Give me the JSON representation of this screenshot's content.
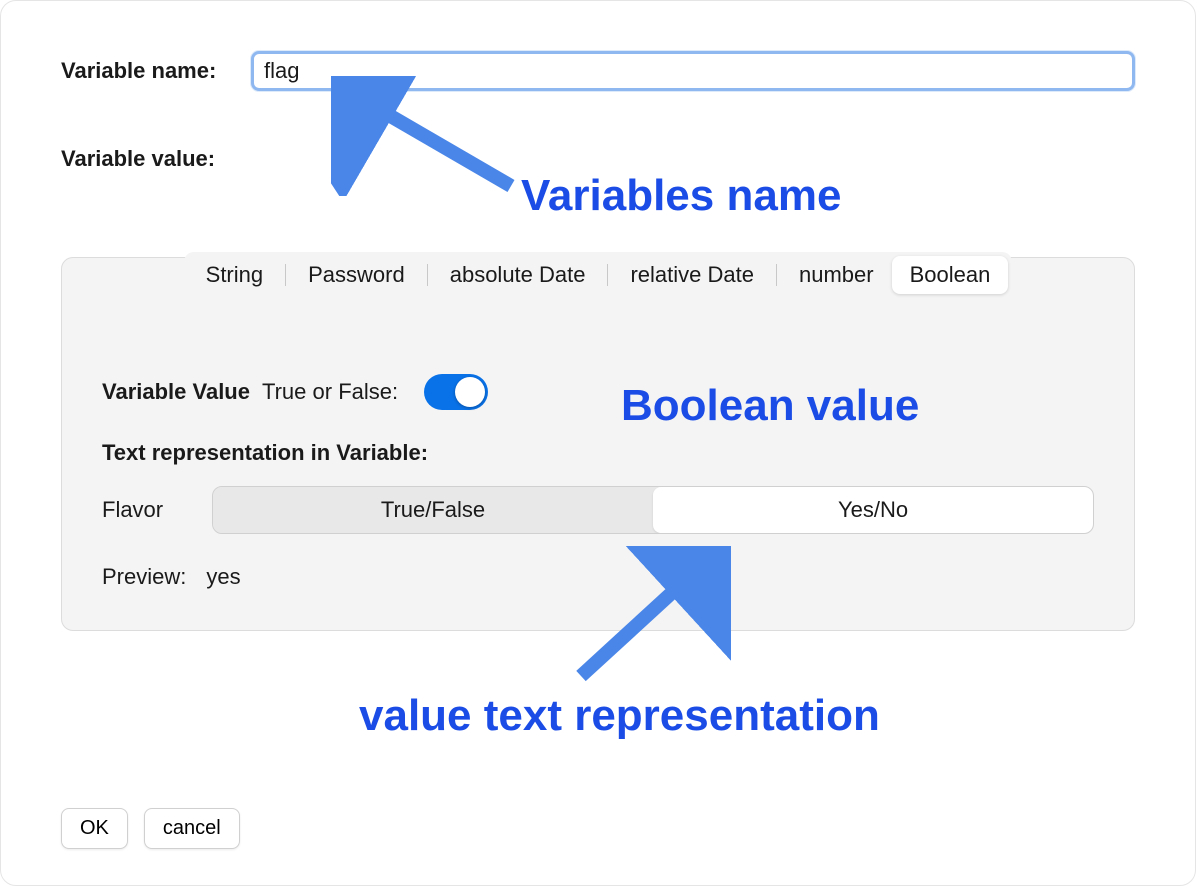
{
  "labels": {
    "variable_name": "Variable name:",
    "variable_value_section": "Variable value:",
    "variable_value_inline": "Variable Value",
    "true_or_false": "True or False:",
    "text_representation": "Text representation in Variable:",
    "flavor": "Flavor",
    "preview": "Preview:"
  },
  "inputs": {
    "variable_name_value": "flag"
  },
  "tabs": {
    "items": [
      "String",
      "Password",
      "absolute Date",
      "relative Date",
      "number",
      "Boolean"
    ],
    "active_index": 5
  },
  "toggle": {
    "on": true
  },
  "segments": {
    "items": [
      "True/False",
      "Yes/No"
    ],
    "active_index": 1
  },
  "preview": {
    "value": "yes"
  },
  "buttons": {
    "ok": "OK",
    "cancel": "cancel"
  },
  "annotations": {
    "variables_name": "Variables name",
    "boolean_value": "Boolean value",
    "value_text_rep": "value text representation"
  }
}
